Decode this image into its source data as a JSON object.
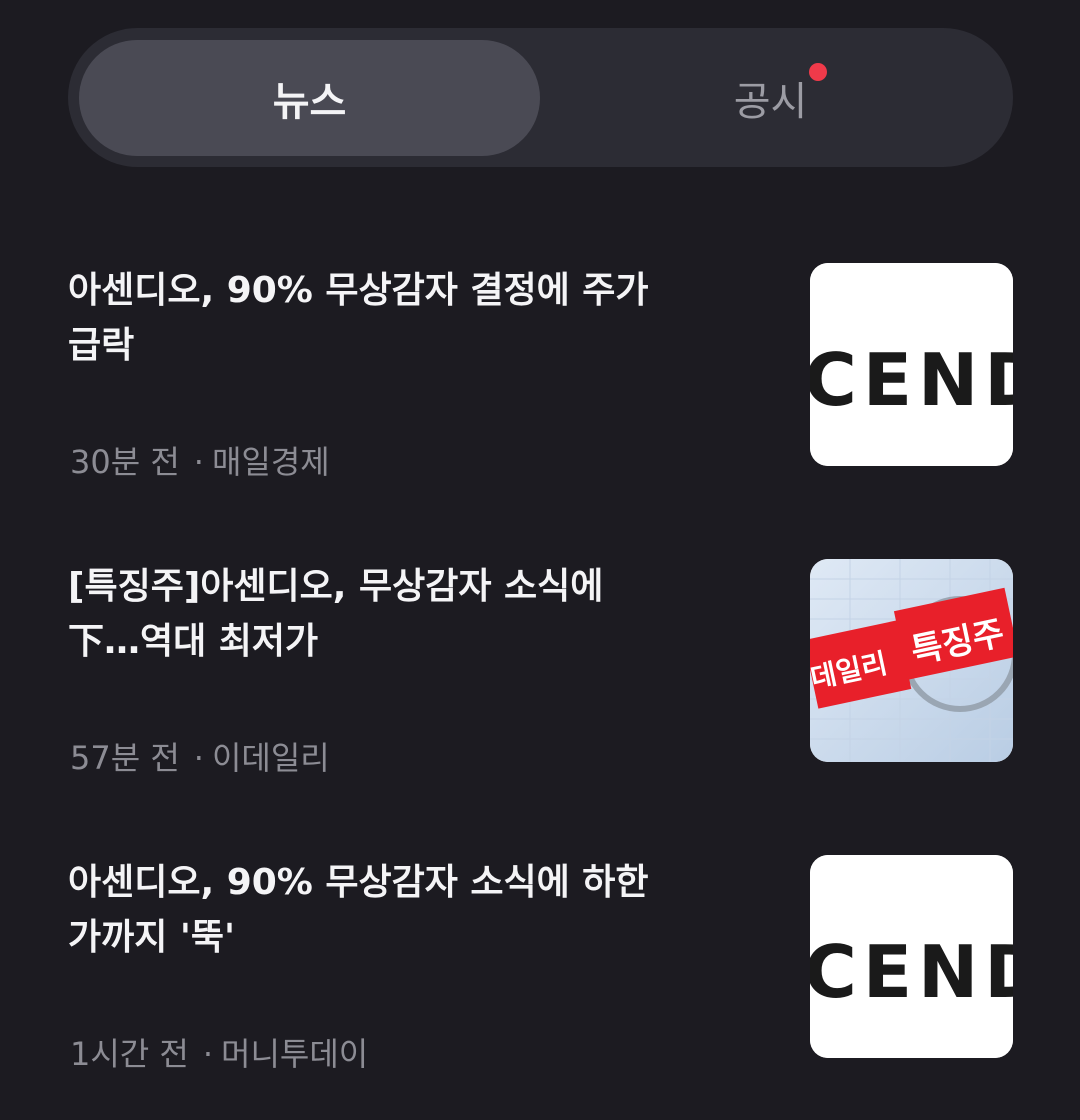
{
  "tabs": {
    "news_label": "뉴스",
    "notice_label": "공시",
    "notice_has_new": true,
    "active_tab": "뉴스"
  },
  "news": [
    {
      "headline": "아센디오, 90% 무상감자 결정에 주가\n급락",
      "time": "30분 전",
      "source": "매일경제",
      "thumbnail_text": "CEND"
    },
    {
      "headline": "[특징주]아센디오, 무상감자 소식에\n下…역대 최저가",
      "time": "57분 전",
      "source": "이데일리",
      "thumbnail_text": "이데일리 특징주"
    },
    {
      "headline": "아센디오, 90% 무상감자 소식에 하한\n가까지 '뚝'",
      "time": "1시간 전",
      "source": "머니투데이",
      "thumbnail_text": "CEND"
    }
  ],
  "colors": {
    "background": "#1c1b21",
    "tabbar": "#2c2c34",
    "active_tab": "#4a4a54",
    "notification_dot": "#f03a4a",
    "meta_text": "#8c8c94"
  }
}
